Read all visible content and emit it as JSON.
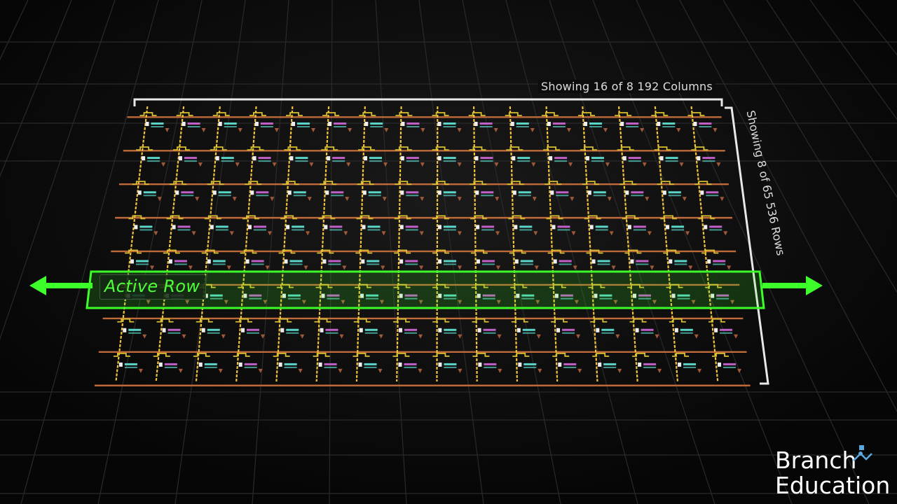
{
  "labels": {
    "columns": "Showing 16 of 8 192 Columns",
    "rows": "Showing 8 of 65 536 Rows",
    "active_row": "Active Row"
  },
  "logo": {
    "line1": "Branch",
    "line2": "Education"
  },
  "icons": [
    "arrow-left-icon",
    "arrow-right-icon",
    "branch-logo-icon"
  ],
  "colors": {
    "background": "#0b0b0b",
    "active_row": "#3cff2a",
    "bitline": "#f2c23c",
    "wordline": "#c06a3a",
    "transistor": "#d8c030",
    "capacitor_a": "#5ad6c8",
    "capacitor_b": "#c060c8",
    "bracket": "#e8e8e8"
  }
}
